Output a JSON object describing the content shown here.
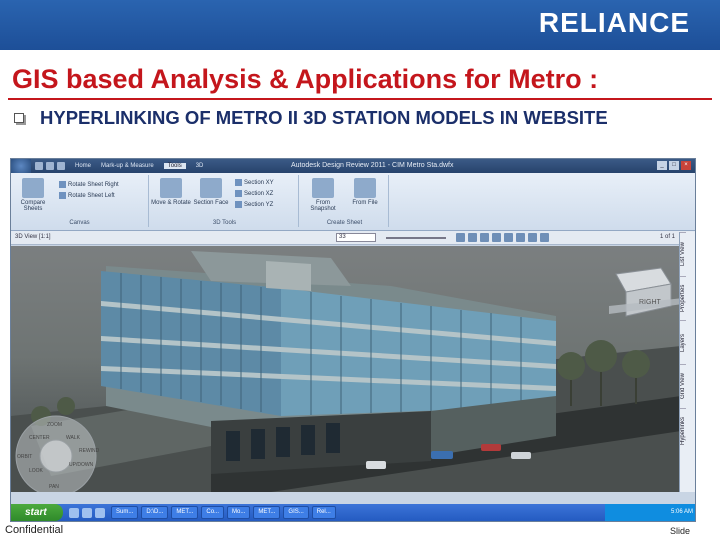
{
  "header": {
    "logo_text": "RELIANCE",
    "brand_color": "#1d4f98"
  },
  "slide": {
    "title": "GIS based Analysis & Applications for Metro :",
    "title_color": "#c4161c",
    "bullet_text": "HYPERLINKING OF METRO II 3D STATION MODELS IN WEBSITE",
    "bullet_color": "#1b2f6a"
  },
  "app": {
    "window_title": "Autodesk Design Review 2011 - CIM Metro Sta.dwfx",
    "tabs": [
      "Home",
      "Mark-up & Measure",
      "Tools",
      "3D"
    ],
    "ribbon": {
      "canvas_group": "Canvas",
      "tools_group": "3D Tools",
      "create_group": "Create Sheet",
      "compare_label": "Compare Sheets",
      "rotate_right_label": "Rotate Sheet Right",
      "rotate_left_label": "Rotate Sheet Left",
      "move_rotate_label": "Move & Rotate",
      "section_face_label": "Section Face",
      "section_xy": "Section XY",
      "section_xz": "Section XZ",
      "section_yz": "Section YZ",
      "from_snapshot_label": "From Snapshot",
      "from_file_label": "From File"
    },
    "viewbar": {
      "view_label": "3D View [1:1]",
      "zoom_value": "33",
      "page_count": "1 of 1"
    },
    "viewcube_label": "RIGHT",
    "wheel_labels": [
      "ZOOM",
      "CENTER",
      "WALK",
      "LOOK",
      "UP/DOWN",
      "PAN",
      "ORBIT",
      "REWIND"
    ],
    "side_panel": [
      "List View",
      "Properties",
      "Layers",
      "Grid View",
      "Hyperlinks"
    ],
    "taskbar": {
      "start_label": "start",
      "items": [
        "Sum...",
        "D:\\D...",
        "MET...",
        "Co...",
        "Mo...",
        "MET...",
        "GIS...",
        "Rel..."
      ],
      "clock": "5:06 AM"
    }
  },
  "footer": {
    "left": "Confidential",
    "right": "Slide"
  }
}
